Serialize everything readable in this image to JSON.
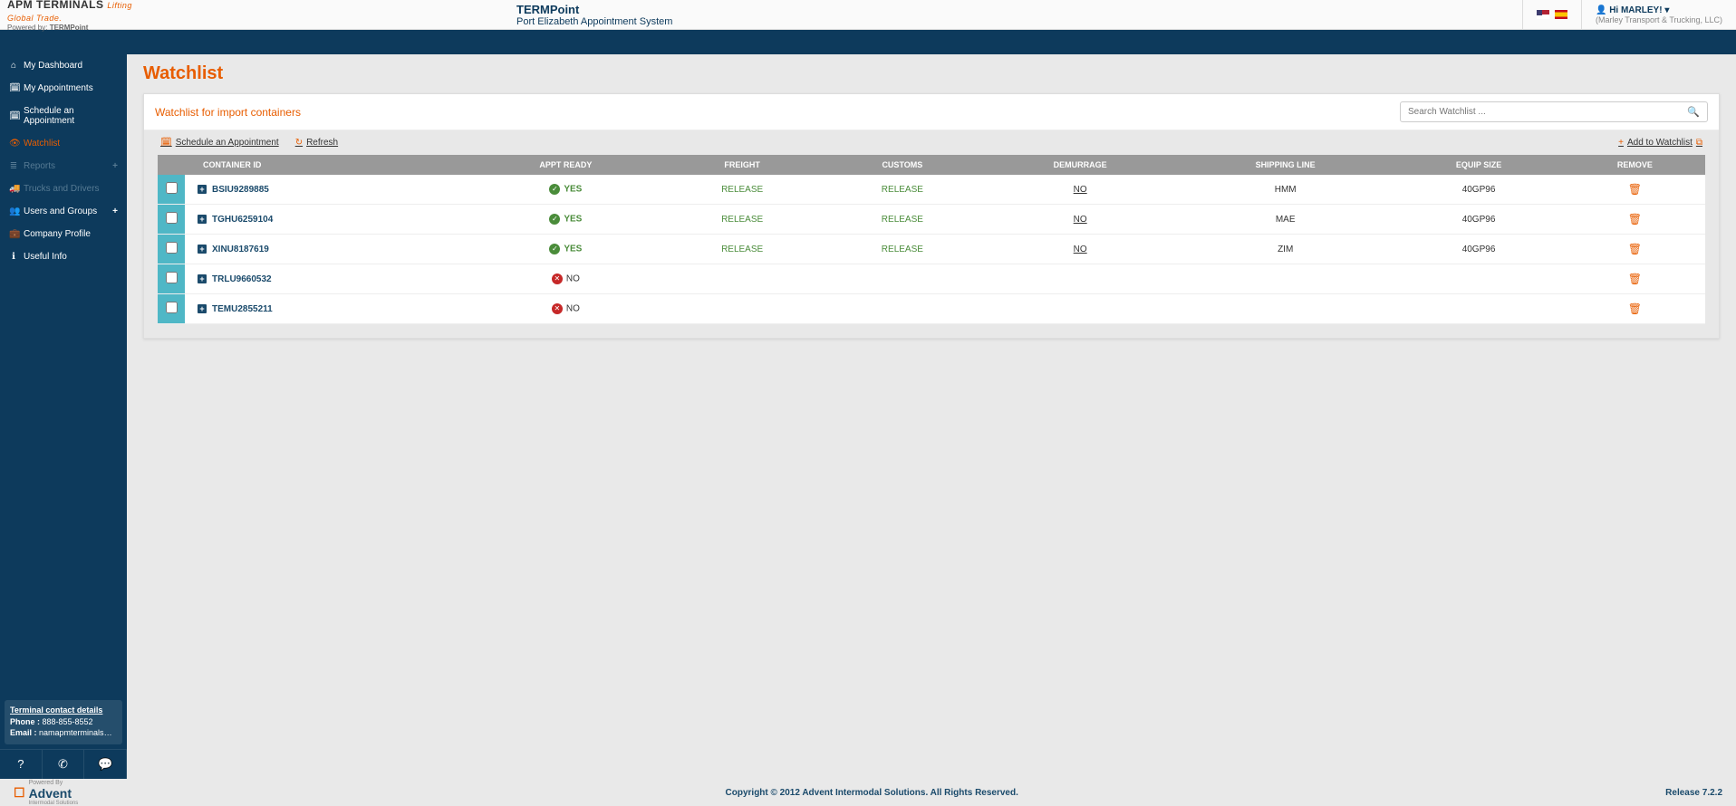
{
  "header": {
    "logo_main": "APM TERMINALS",
    "logo_tag": "Lifting Global Trade.",
    "powered_label": "Powered by:",
    "powered_name": "TERMPoint",
    "app_title": "TERMPoint",
    "app_sub": "Port Elizabeth Appointment System",
    "user_greeting": "Hi MARLEY!",
    "user_company": "(Marley Transport & Trucking, LLC)"
  },
  "sidebar": {
    "items": [
      {
        "label": "My Dashboard",
        "icon": "⌂"
      },
      {
        "label": "My Appointments",
        "icon": "🗓"
      },
      {
        "label": "Schedule an Appointment",
        "icon": "🗓"
      },
      {
        "label": "Watchlist",
        "icon": "👁"
      },
      {
        "label": "Reports",
        "icon": "≣",
        "disabled": true,
        "plus": true
      },
      {
        "label": "Trucks and Drivers",
        "icon": "🚚",
        "disabled": true
      },
      {
        "label": "Users and Groups",
        "icon": "👥",
        "plus": true
      },
      {
        "label": "Company Profile",
        "icon": "💼"
      },
      {
        "label": "Useful Info",
        "icon": "ℹ"
      }
    ],
    "contact": {
      "title": "Terminal contact details",
      "phone_label": "Phone :",
      "phone": "888-855-8552",
      "email_label": "Email :",
      "email": "namapmterminals@apmt..."
    }
  },
  "page": {
    "title": "Watchlist",
    "panel_title": "Watchlist for import containers",
    "search_placeholder": "Search Watchlist ...",
    "toolbar": {
      "schedule": "Schedule an Appointment",
      "refresh": "Refresh",
      "add": "Add to Watchlist"
    },
    "columns": [
      "",
      "CONTAINER ID",
      "APPT READY",
      "FREIGHT",
      "CUSTOMS",
      "DEMURRAGE",
      "SHIPPING LINE",
      "EQUIP SIZE",
      "REMOVE"
    ],
    "rows": [
      {
        "container": "BSIU9289885",
        "ready": "YES",
        "freight": "RELEASE",
        "customs": "RELEASE",
        "demurrage": "NO",
        "line": "HMM",
        "size": "40GP96"
      },
      {
        "container": "TGHU6259104",
        "ready": "YES",
        "freight": "RELEASE",
        "customs": "RELEASE",
        "demurrage": "NO",
        "line": "MAE",
        "size": "40GP96"
      },
      {
        "container": "XINU8187619",
        "ready": "YES",
        "freight": "RELEASE",
        "customs": "RELEASE",
        "demurrage": "NO",
        "line": "ZIM",
        "size": "40GP96"
      },
      {
        "container": "TRLU9660532",
        "ready": "NO",
        "freight": "",
        "customs": "",
        "demurrage": "",
        "line": "",
        "size": ""
      },
      {
        "container": "TEMU2855211",
        "ready": "NO",
        "freight": "",
        "customs": "",
        "demurrage": "",
        "line": "",
        "size": ""
      }
    ]
  },
  "footer": {
    "advent_top": "Powered By",
    "advent": "Advent",
    "advent_sub": "Intermodal Solutions",
    "copyright": "Copyright © 2012 Advent Intermodal Solutions. All Rights Reserved.",
    "release": "Release 7.2.2"
  }
}
